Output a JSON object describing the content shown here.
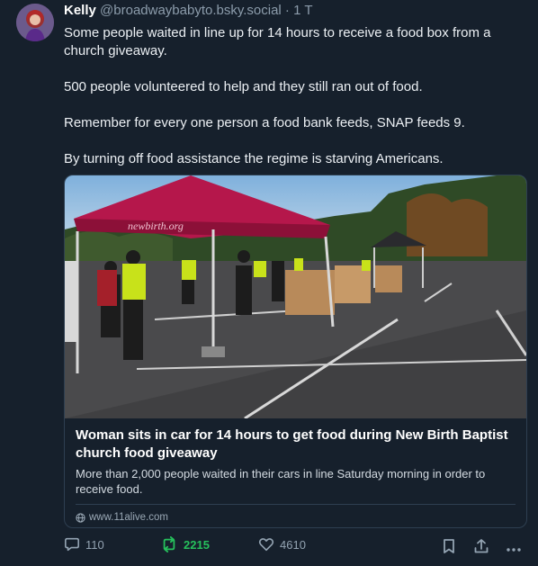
{
  "post": {
    "author": {
      "display_name": "Kelly",
      "handle": "@broadwaybabyto.bsky.social",
      "separator": "·",
      "time": "1 T"
    },
    "paragraphs": [
      "Some people waited in line up for 14 hours to receive a food box from a church giveaway.",
      "500 people volunteered to help and they still ran out of food.",
      "Remember for every one person a food bank feeds, SNAP feeds 9.",
      "By turning off food assistance the regime is starving Americans."
    ]
  },
  "link_card": {
    "image_tent_text": "newbirth.org",
    "title": "Woman sits in car for 14 hours to get food during New Birth Baptist church food giveaway",
    "description": "More than 2,000 people waited in their cars in line Saturday morning in order to receive food.",
    "source": "www.11alive.com",
    "source_icon": "globe-icon"
  },
  "actions": {
    "reply": {
      "icon": "reply-icon",
      "count": "110"
    },
    "repost": {
      "icon": "repost-icon",
      "count": "2215",
      "active": true
    },
    "like": {
      "icon": "heart-icon",
      "count": "4610"
    },
    "bookmark": {
      "icon": "bookmark-icon"
    },
    "share": {
      "icon": "share-icon"
    },
    "more": {
      "icon": "more-icon"
    }
  },
  "colors": {
    "background": "#16202c",
    "text": "#ecf0f4",
    "muted": "#8c9cab",
    "repost_active": "#26c05c",
    "border": "#2e3f51",
    "tent": "#b5174b"
  }
}
